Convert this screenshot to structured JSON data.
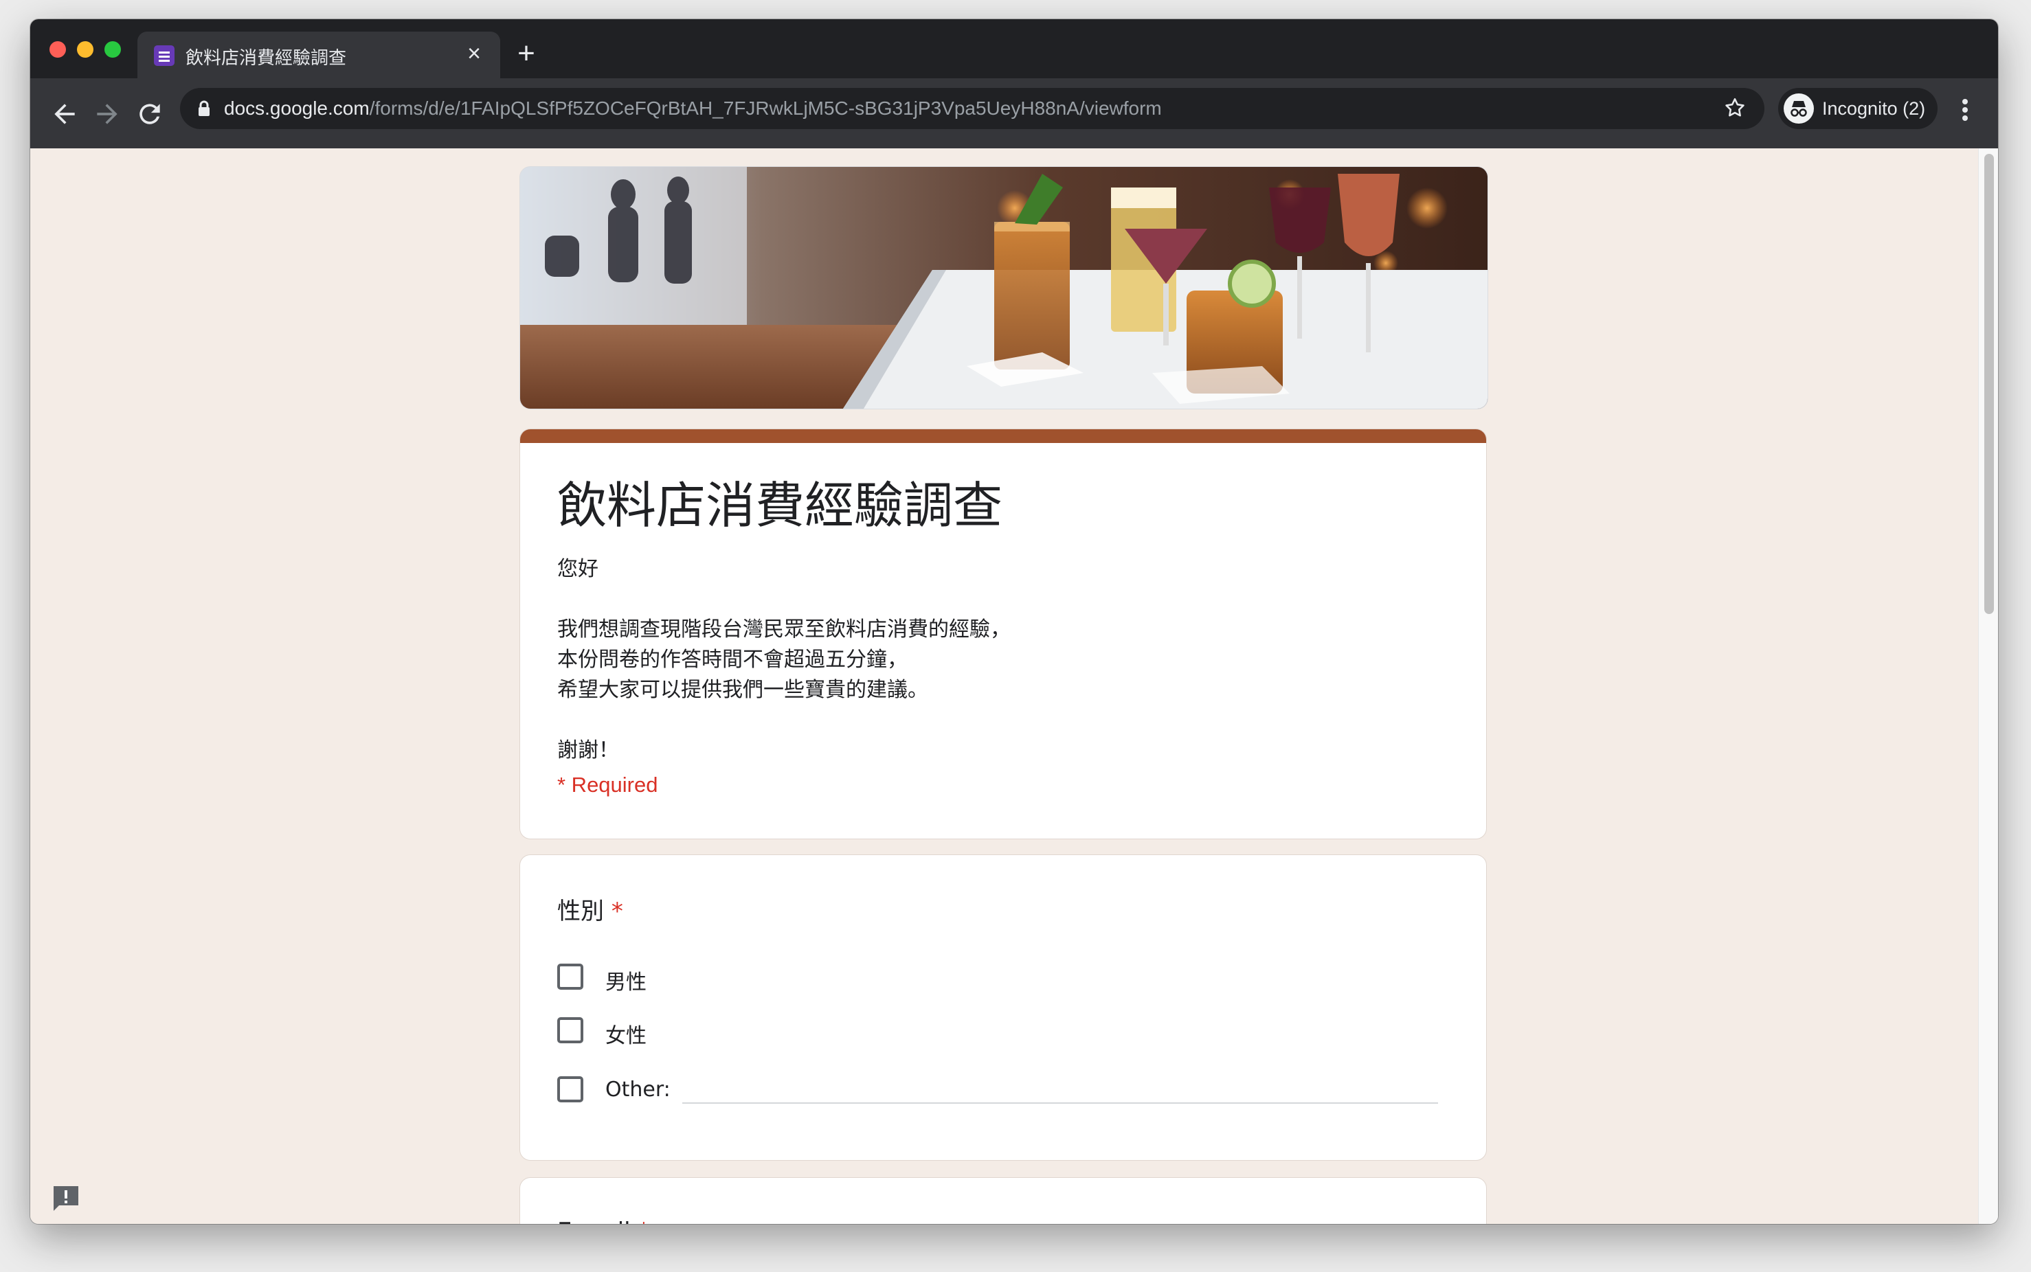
{
  "browser": {
    "tab_title": "飲料店消費經驗調查",
    "tab_close_icon": "close-icon",
    "new_tab_icon": "plus-icon",
    "url_host": "docs.google.com",
    "url_path": "/forms/d/e/1FAIpQLSfPf5ZOCeFQrBtAH_7FJRwkLjM5C-sBG31jP3Vpa5UeyH88nA/viewform",
    "incognito_label": "Incognito (2)"
  },
  "form": {
    "accent_color": "#a0522d",
    "title": "飲料店消費經驗調查",
    "description_lines": [
      "您好",
      "",
      "我們想調查現階段台灣民眾至飲料店消費的經驗，",
      "本份問卷的作答時間不會超過五分鐘，",
      "希望大家可以提供我們一些寶貴的建議。",
      "",
      "謝謝！"
    ],
    "required_note": "* Required",
    "questions": [
      {
        "title": "性別",
        "required_mark": "*",
        "options": [
          "男性",
          "女性",
          "Other:"
        ]
      },
      {
        "title": "E-mail",
        "required_mark": "*"
      }
    ]
  }
}
